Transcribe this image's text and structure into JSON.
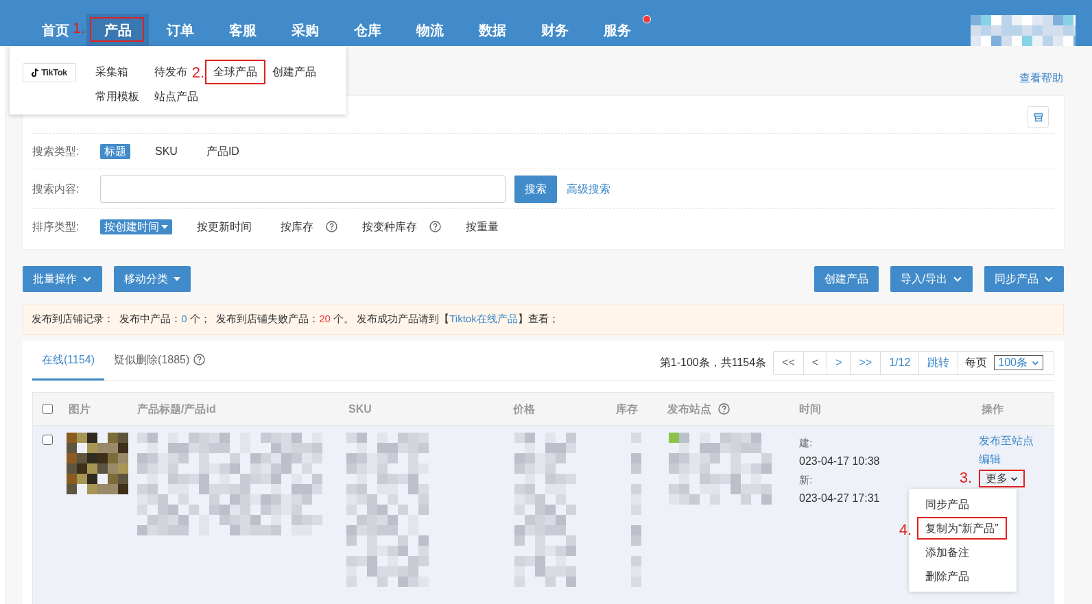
{
  "nav": {
    "items": [
      {
        "label": "首页",
        "selected": false,
        "highlighted": false,
        "notification_dot": false
      },
      {
        "label": "产品",
        "selected": true,
        "highlighted": true,
        "marker": "1.",
        "notification_dot": false
      },
      {
        "label": "订单",
        "selected": false,
        "highlighted": false,
        "notification_dot": false
      },
      {
        "label": "客服",
        "selected": false,
        "highlighted": false,
        "notification_dot": false
      },
      {
        "label": "采购",
        "selected": false,
        "highlighted": false,
        "notification_dot": false
      },
      {
        "label": "仓库",
        "selected": false,
        "highlighted": false,
        "notification_dot": false
      },
      {
        "label": "物流",
        "selected": false,
        "highlighted": false,
        "notification_dot": false
      },
      {
        "label": "数据",
        "selected": false,
        "highlighted": false,
        "notification_dot": false
      },
      {
        "label": "财务",
        "selected": false,
        "highlighted": false,
        "notification_dot": false
      },
      {
        "label": "服务",
        "selected": false,
        "highlighted": false,
        "notification_dot": true
      }
    ]
  },
  "product_menu": {
    "logo_text": "TikTok",
    "rows": [
      [
        {
          "label": "采集箱",
          "highlighted": false
        },
        {
          "label": "待发布",
          "highlighted": false
        },
        {
          "label": "全球产品",
          "highlighted": true,
          "marker": "2."
        },
        {
          "label": "创建产品",
          "highlighted": false
        }
      ],
      [
        {
          "label": "常用模板",
          "highlighted": false
        },
        {
          "label": "站点产品",
          "highlighted": false
        }
      ]
    ]
  },
  "help_link": "查看帮助",
  "filters": [
    {
      "kind": "hidden"
    },
    {
      "kind": "options",
      "label": "搜索类型:",
      "options": [
        {
          "label": "标题",
          "selected": true,
          "dropdown": false,
          "kind": "plain"
        },
        {
          "label": "SKU",
          "selected": false,
          "dropdown": false,
          "kind": "plain"
        },
        {
          "label": "产品ID",
          "selected": false,
          "dropdown": false,
          "kind": "plain"
        }
      ]
    },
    {
      "kind": "search",
      "label": "搜索内容:",
      "button": "搜索",
      "link": "高级搜索"
    },
    {
      "kind": "options",
      "label": "排序类型:",
      "options": [
        {
          "label": "按创建时间",
          "selected": true,
          "dropdown": true,
          "kind": "plain"
        },
        {
          "label": "按更新时间",
          "selected": false,
          "dropdown": false,
          "kind": "plain"
        },
        {
          "label": "按库存",
          "selected": false,
          "dropdown": false,
          "kind": "with_help"
        },
        {
          "label": "按变种库存",
          "selected": false,
          "dropdown": false,
          "kind": "with_help"
        },
        {
          "label": "按重量",
          "selected": false,
          "dropdown": false,
          "kind": "plain"
        }
      ]
    }
  ],
  "toolbar": {
    "left": [
      {
        "label": "批量操作",
        "kind": "chevron"
      },
      {
        "label": "移动分类",
        "kind": "triangle"
      }
    ],
    "right": [
      {
        "label": "创建产品",
        "kind": "plain"
      },
      {
        "label": "导入/导出",
        "kind": "chevron"
      },
      {
        "label": "同步产品",
        "kind": "chevron"
      }
    ]
  },
  "notice": [
    {
      "kind": "plain",
      "text": "发布到店铺记录：  发布中产品："
    },
    {
      "kind": "blue",
      "text": "0"
    },
    {
      "kind": "plain",
      "text": " 个；  发布到店铺失败产品："
    },
    {
      "kind": "red",
      "text": "20"
    },
    {
      "kind": "plain",
      "text": " 个。 发布成功产品请到【"
    },
    {
      "kind": "link",
      "text": "Tiktok在线产品"
    },
    {
      "kind": "plain",
      "text": "】查看；"
    }
  ],
  "tabs": [
    {
      "label": "在线(1154)",
      "selected": true,
      "kind": "plain"
    },
    {
      "label": "疑似删除(1885)",
      "selected": false,
      "kind": "with_help"
    }
  ],
  "pagination": {
    "summary": "第1-100条，共1154条",
    "buttons": [
      {
        "label": "<<",
        "kind": "nav"
      },
      {
        "label": "<",
        "kind": "nav"
      },
      {
        "label": ">",
        "kind": "link"
      },
      {
        "label": ">>",
        "kind": "link"
      },
      {
        "label": "1/12",
        "kind": "link"
      },
      {
        "label": "跳转",
        "kind": "link"
      }
    ],
    "per_page_label": "每页",
    "per_page": "100条"
  },
  "table": {
    "select_all_checked": false,
    "columns": [
      {
        "label": "图片",
        "kind": "plain"
      },
      {
        "label": "产品标题/产品id",
        "kind": "plain"
      },
      {
        "label": "SKU",
        "kind": "plain"
      },
      {
        "label": "价格",
        "kind": "plain"
      },
      {
        "label": "库存",
        "kind": "plain"
      },
      {
        "label": "发布站点",
        "kind": "with_help"
      },
      {
        "label": "时间",
        "kind": "plain"
      },
      {
        "label": "操作",
        "kind": "plain"
      }
    ],
    "rows": [
      {
        "checked": false,
        "created_label": "建:",
        "created": "023-04-17 10:38",
        "updated_label": "新:",
        "updated": "023-04-27 17:31",
        "actions": [
          {
            "kind": "link",
            "label": "发布至站点",
            "highlighted": false
          },
          {
            "kind": "link",
            "label": "编辑",
            "highlighted": false
          },
          {
            "kind": "more",
            "label": "更多",
            "highlighted": true,
            "marker": "3."
          }
        ],
        "more_menu": [
          {
            "label": "同步产品",
            "highlighted": false
          },
          {
            "label": "复制为“新产品”",
            "highlighted": true,
            "marker": "4."
          },
          {
            "label": "添加备注",
            "highlighted": false
          },
          {
            "label": "删除产品",
            "highlighted": false
          }
        ]
      }
    ]
  }
}
